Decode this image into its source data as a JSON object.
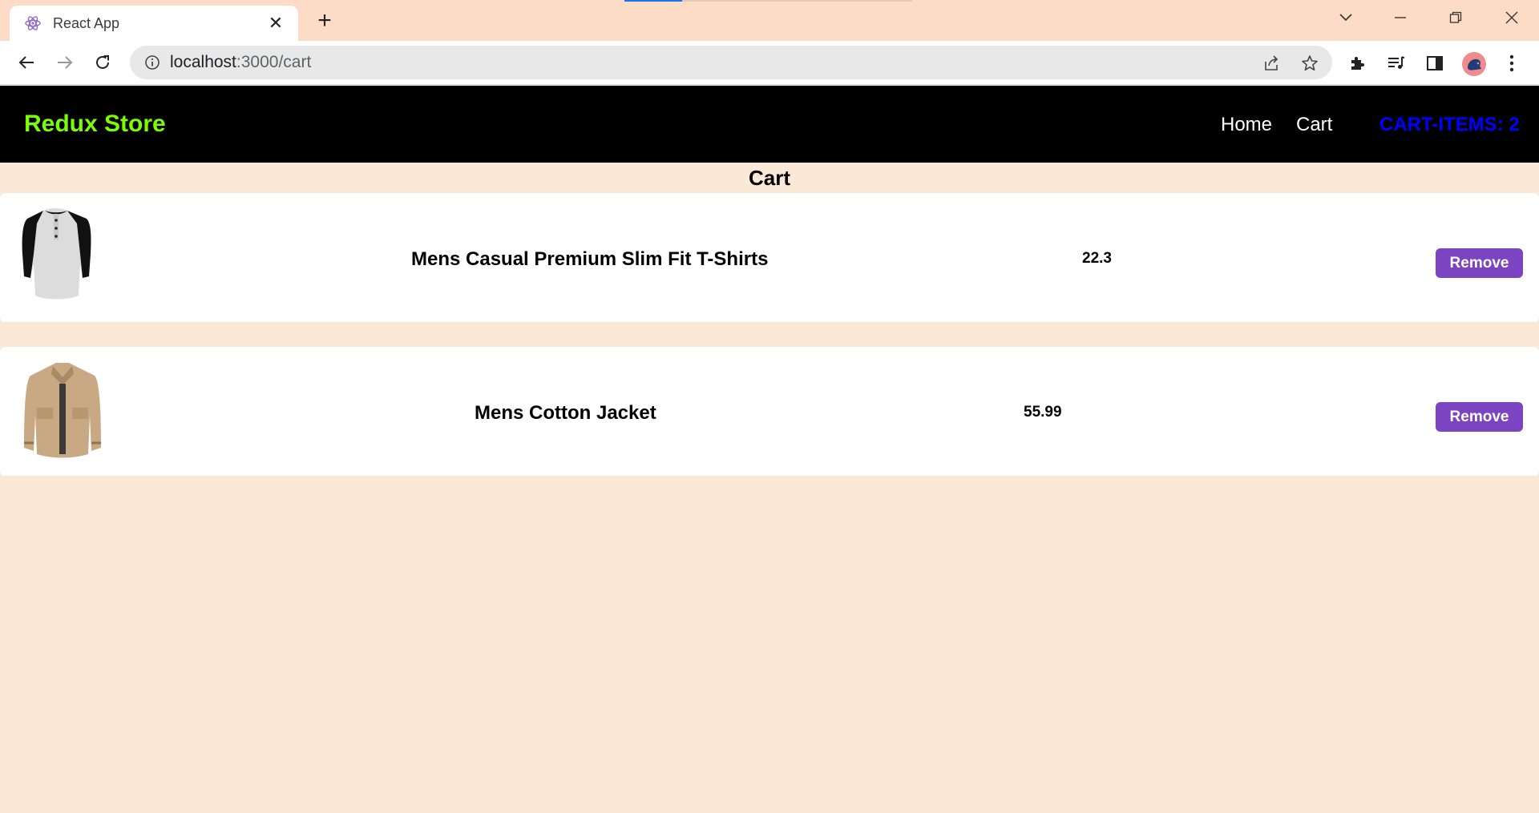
{
  "browser": {
    "tab_title": "React App",
    "url_host": "localhost",
    "url_path": ":3000/cart"
  },
  "navbar": {
    "brand": "Redux Store",
    "links": [
      "Home",
      "Cart"
    ],
    "cart_items_label": "CART-ITEMS: 2"
  },
  "page": {
    "heading": "Cart"
  },
  "cart": {
    "items": [
      {
        "title": "Mens Casual Premium Slim Fit T-Shirts",
        "price": "22.3",
        "button": "Remove"
      },
      {
        "title": "Mens Cotton Jacket",
        "price": "55.99",
        "button": "Remove"
      }
    ]
  },
  "colors": {
    "brand": "#7cfc00",
    "cart_count": "#0000ff",
    "remove_button": "#7b45c1",
    "page_bg": "#fae9d7",
    "tabbar_bg": "#fcdcc7"
  }
}
